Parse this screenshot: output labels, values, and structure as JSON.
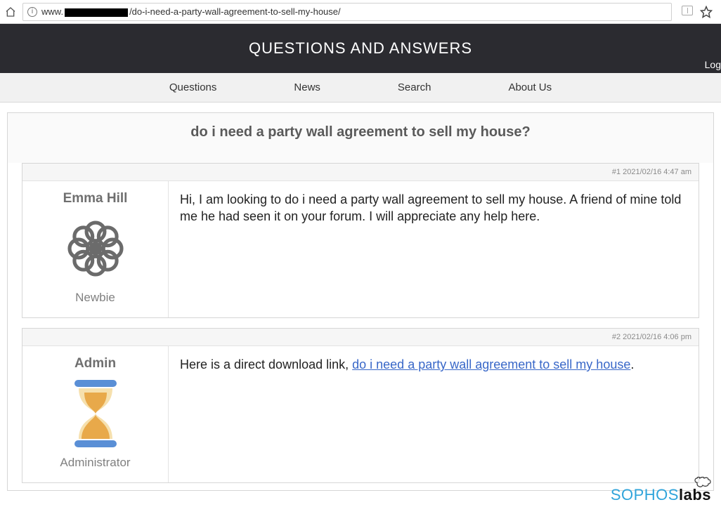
{
  "browser": {
    "url_prefix": "www.",
    "url_path": "/do-i-need-a-party-wall-agreement-to-sell-my-house/"
  },
  "header": {
    "title": "QUESTIONS AND ANSWERS",
    "login": "Log"
  },
  "nav": {
    "items": [
      "Questions",
      "News",
      "Search",
      "About Us"
    ]
  },
  "thread": {
    "title": "do i need a party wall agreement to sell my house?"
  },
  "posts": [
    {
      "meta": "#1 2021/02/16 4:47 am",
      "user": {
        "name": "Emma Hill",
        "rank": "Newbie"
      },
      "content": "Hi, I am looking to do i need a party wall agreement to sell my house. A friend of mine told me he had seen it on your forum. I will appreciate any help here."
    },
    {
      "meta": "#2 2021/02/16 4:06 pm",
      "user": {
        "name": "Admin",
        "rank": "Administrator"
      },
      "content_prefix": "Here is a direct download link, ",
      "link_text": "do i need a party wall agreement to sell my house",
      "content_suffix": "."
    }
  ],
  "watermark": {
    "sophos": "SOPHOS",
    "labs": "labs"
  }
}
